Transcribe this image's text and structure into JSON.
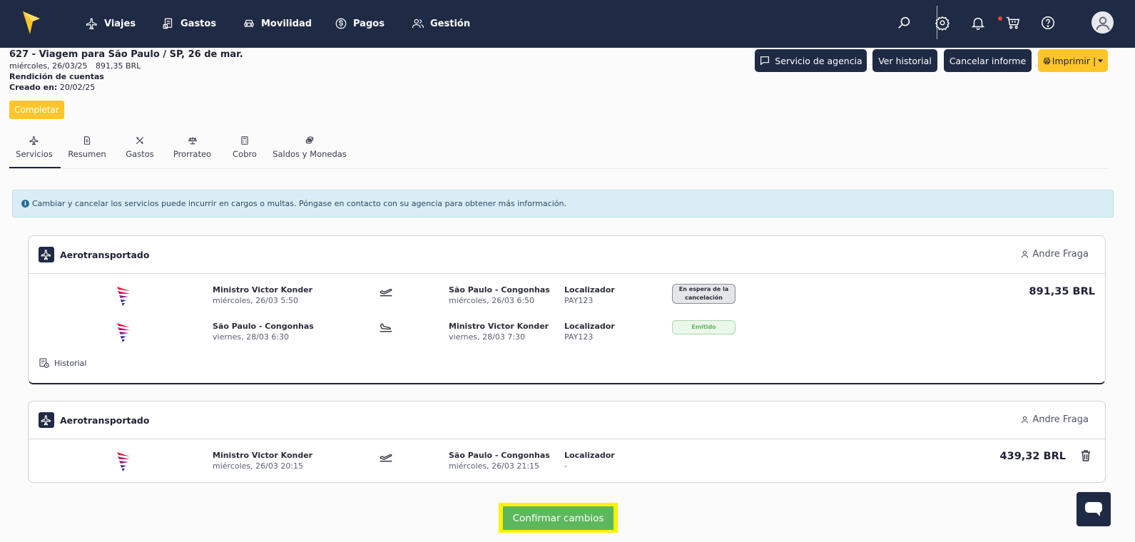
{
  "nav": {
    "items": [
      {
        "label": "Viajes",
        "icon": "plane-icon"
      },
      {
        "label": "Gastos",
        "icon": "receipt-icon"
      },
      {
        "label": "Movilidad",
        "icon": "car-icon"
      },
      {
        "label": "Pagos",
        "icon": "dollar-icon"
      },
      {
        "label": "Gestión",
        "icon": "users-icon"
      }
    ],
    "right_icons": [
      "search-icon",
      "gear-icon",
      "bell-icon",
      "cart-icon",
      "help-icon",
      "avatar"
    ]
  },
  "trip": {
    "title": "627 - Viagem para São Paulo / SP, 26 de mar.",
    "date": "miércoles, 26/03/25",
    "amount": "891,35 BRL",
    "type": "Rendición de cuentas",
    "created_label": "Creado en:",
    "created_value": "20/02/25",
    "complete_label": "Completar"
  },
  "header_buttons": {
    "agency": "Servicio de agencia",
    "history": "Ver historial",
    "cancel": "Cancelar informe",
    "print": "Imprimir |"
  },
  "tabs": [
    {
      "label": "Servicios",
      "active": true
    },
    {
      "label": "Resumen"
    },
    {
      "label": "Gastos"
    },
    {
      "label": "Prorrateo"
    },
    {
      "label": "Cobro"
    },
    {
      "label": "Saldos y Monedas"
    }
  ],
  "alert": {
    "text": "Cambiar y cancelar los servicios puede incurrir en cargos o multas. Póngase en contacto con su agencia para obtener más información."
  },
  "cards": [
    {
      "title": "Aerotransportado",
      "user": "Andre Fraga",
      "price": "891,35 BRL",
      "segments": [
        {
          "from_city": "Ministro Victor Konder",
          "from_time": "miércoles, 26/03 5:50",
          "to_city": "São Paulo - Congonhas",
          "to_time": "miércoles, 26/03 6:50",
          "loc_label": "Localizador",
          "loc_value": "PAY123",
          "status": "En espera de la cancelación"
        },
        {
          "from_city": "São Paulo - Congonhas",
          "from_time": "viernes, 28/03 6:30",
          "to_city": "Ministro Victor Konder",
          "to_time": "viernes, 28/03 7:30",
          "loc_label": "Localizador",
          "loc_value": "PAY123",
          "status": "Emitido"
        }
      ],
      "history_label": "Historial"
    },
    {
      "title": "Aerotransportado",
      "user": "Andre Fraga",
      "price": "439,32 BRL",
      "segments": [
        {
          "from_city": "Ministro Victor Konder",
          "from_time": "miércoles, 26/03 20:15",
          "to_city": "São Paulo - Congonhas",
          "to_time": "miércoles, 26/03 21:15",
          "loc_label": "Localizador",
          "loc_value": "-"
        }
      ]
    }
  ],
  "confirm_label": "Confirmar cambios",
  "colors": {
    "navy": "#1f2a44",
    "yellow": "#ffc629",
    "green": "#5cb85c",
    "highlight": "#fff200"
  }
}
